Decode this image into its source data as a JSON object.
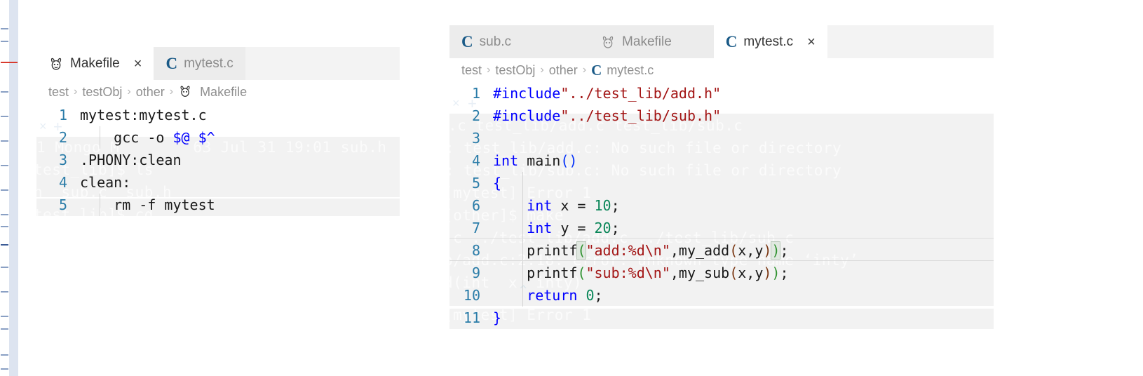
{
  "app": {
    "kind": "vscode-editor-split"
  },
  "ruler": {
    "name": "overview-ruler"
  },
  "left_pane": {
    "tabs": [
      {
        "label": "Makefile",
        "icon": "gnu-icon",
        "active": true,
        "closable": true
      },
      {
        "label": "mytest.c",
        "icon": "c-icon",
        "active": false,
        "closable": false
      }
    ],
    "close_glyph": "×",
    "breadcrumb": {
      "items": [
        "test",
        "testObj",
        "other",
        "Makefile"
      ],
      "separator": "›",
      "leaf_icon": "gnu-icon"
    },
    "editor": {
      "language": "makefile",
      "lines": [
        {
          "n": "1",
          "tokens": [
            {
              "t": "mytest:mytest.c",
              "c": "txt"
            }
          ]
        },
        {
          "n": "2",
          "tokens": [
            {
              "t": "    gcc -o ",
              "c": "txt"
            },
            {
              "t": "$@",
              "c": "var"
            },
            {
              "t": " ",
              "c": "txt"
            },
            {
              "t": "$^",
              "c": "var"
            }
          ]
        },
        {
          "n": "3",
          "tokens": [
            {
              "t": ".PHONY:clean",
              "c": "txt"
            }
          ]
        },
        {
          "n": "4",
          "tokens": [
            {
              "t": "clean:",
              "c": "txt"
            }
          ]
        },
        {
          "n": "5",
          "tokens": [
            {
              "t": "    rm -f mytest",
              "c": "txt"
            }
          ]
        }
      ]
    },
    "ghost_terminal": [
      "1 Mongo M        63 Jul 31 19:01 sub.h",
      "test_lib]$ ls",
      "h  sub.c  sub.h",
      "test_lib]$ cd.."
    ]
  },
  "right_pane": {
    "tabs": [
      {
        "label": "sub.c",
        "icon": "c-icon",
        "active": false,
        "closable": false
      },
      {
        "label": "Makefile",
        "icon": "gnu-icon",
        "active": false,
        "closable": false
      },
      {
        "label": "mytest.c",
        "icon": "c-icon",
        "active": true,
        "closable": true
      }
    ],
    "close_glyph": "×",
    "breadcrumb": {
      "items": [
        "test",
        "testObj",
        "other",
        "mytest.c"
      ],
      "separator": "›",
      "leaf_icon": "c-icon"
    },
    "editor": {
      "language": "c",
      "active_line": 8,
      "lines": [
        {
          "n": "1",
          "tokens": [
            {
              "t": "#include",
              "c": "kw"
            },
            {
              "t": "\"../test_lib/add.h\"",
              "c": "str"
            }
          ]
        },
        {
          "n": "2",
          "tokens": [
            {
              "t": "#include",
              "c": "kw"
            },
            {
              "t": "\"../test_lib/sub.h\"",
              "c": "str"
            }
          ]
        },
        {
          "n": "3",
          "tokens": [
            {
              "t": "",
              "c": "txt"
            }
          ]
        },
        {
          "n": "4",
          "tokens": [
            {
              "t": "int",
              "c": "kw"
            },
            {
              "t": " ",
              "c": "txt"
            },
            {
              "t": "main",
              "c": "fn"
            },
            {
              "t": "()",
              "c": "paren0"
            }
          ]
        },
        {
          "n": "5",
          "tokens": [
            {
              "t": "{",
              "c": "kw"
            }
          ]
        },
        {
          "n": "6",
          "tokens": [
            {
              "t": "    ",
              "c": "txt"
            },
            {
              "t": "int",
              "c": "kw"
            },
            {
              "t": " x = ",
              "c": "txt"
            },
            {
              "t": "10",
              "c": "num"
            },
            {
              "t": ";",
              "c": "txt"
            }
          ]
        },
        {
          "n": "7",
          "tokens": [
            {
              "t": "    ",
              "c": "txt"
            },
            {
              "t": "int",
              "c": "kw"
            },
            {
              "t": " y = ",
              "c": "txt"
            },
            {
              "t": "20",
              "c": "num"
            },
            {
              "t": ";",
              "c": "txt"
            }
          ]
        },
        {
          "n": "8",
          "tokens": [
            {
              "t": "    printf",
              "c": "txt"
            },
            {
              "t": "(",
              "c": "paren1 bmatch"
            },
            {
              "t": "\"add:%d\\n\"",
              "c": "str"
            },
            {
              "t": ",my_add",
              "c": "txt"
            },
            {
              "t": "(",
              "c": "paren2"
            },
            {
              "t": "x,y",
              "c": "txt"
            },
            {
              "t": ")",
              "c": "paren2"
            },
            {
              "t": ")",
              "c": "paren1 bmatch"
            },
            {
              "t": ";",
              "c": "txt"
            }
          ]
        },
        {
          "n": "9",
          "tokens": [
            {
              "t": "    printf",
              "c": "txt"
            },
            {
              "t": "(",
              "c": "paren1"
            },
            {
              "t": "\"sub:%d\\n\"",
              "c": "str"
            },
            {
              "t": ",my_sub",
              "c": "txt"
            },
            {
              "t": "(",
              "c": "paren2"
            },
            {
              "t": "x,y",
              "c": "txt"
            },
            {
              "t": ")",
              "c": "paren2"
            },
            {
              "t": ")",
              "c": "paren1"
            },
            {
              "t": ";",
              "c": "txt"
            }
          ]
        },
        {
          "n": "10",
          "tokens": [
            {
              "t": "    ",
              "c": "txt"
            },
            {
              "t": "return",
              "c": "kw"
            },
            {
              "t": " ",
              "c": "txt"
            },
            {
              "t": "0",
              "c": "num"
            },
            {
              "t": ";",
              "c": "txt"
            }
          ]
        },
        {
          "n": "11",
          "tokens": [
            {
              "t": "}",
              "c": "kw"
            }
          ]
        }
      ]
    },
    "ghost_terminal": [
      ".c test_lib/add.c test_lib/sub.c",
      ": test_lib/add.c: No such file or directory",
      ": test_lib/sub.c: No such file or directory",
      "[mytest] Error 1",
      "[other]$ make",
      ".c ../test_lib/add.c ../test_lib/sub.c",
      "b/add.c:2:18: error: unknown type name ‘inty’",
      "d(int  x  inty)",
      "[mytest] Error 1"
    ]
  },
  "colors": {
    "keyword": "#0000ff",
    "string": "#a31515",
    "number": "#098658",
    "line_number": "#2a7ca8",
    "tab_inactive_bg": "#ececec",
    "tab_active_bg": "#ffffff",
    "tabbar_bg": "#f3f3f3",
    "ghost_band": "#f2f2f2",
    "bracket_match_bg": "#e0e8e0"
  }
}
